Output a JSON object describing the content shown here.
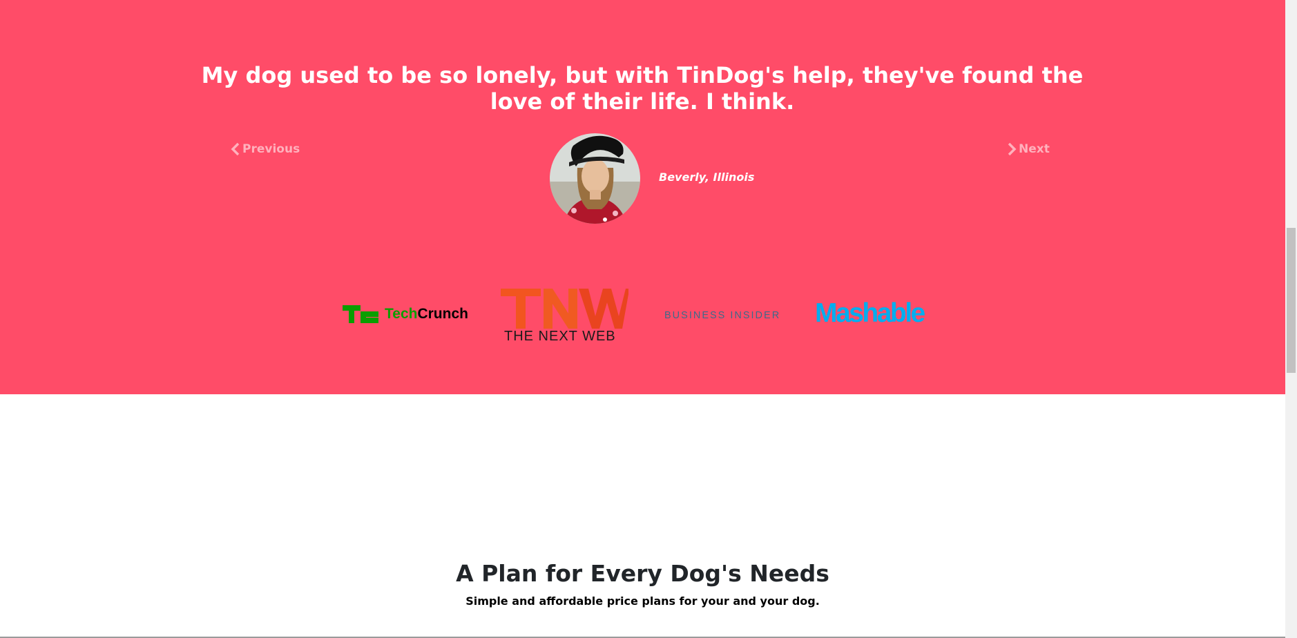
{
  "testimonial": {
    "quote": "My dog used to be so lonely, but with TinDog's help, they've found the love of their life. I think.",
    "author": "Beverly, Illinois",
    "previous_label": "Previous",
    "next_label": "Next"
  },
  "press": {
    "techcrunch": {
      "part1": "Tech",
      "part2": "Crunch"
    },
    "tnw": {
      "tagline": "THE NEXT WEB"
    },
    "business_insider": "BUSINESS INSIDER",
    "mashable": "Mashable"
  },
  "pricing": {
    "title": "A Plan for Every Dog's Needs",
    "subtitle": "Simple and affordable price plans for your and your dog."
  },
  "colors": {
    "section_bg": "#ff4c68",
    "techcrunch_green": "#0a9e01",
    "tnw_orange": "#f2551f",
    "mashable_blue": "#00aeef",
    "business_insider_blue": "#3e6a8a"
  }
}
